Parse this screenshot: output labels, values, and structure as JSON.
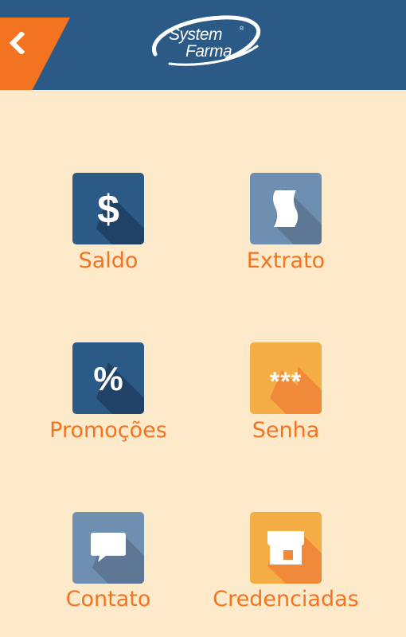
{
  "header": {
    "back_icon": "chevron-left-icon",
    "logo_line1": "System",
    "logo_line2": "Farma",
    "logo_reg": "®"
  },
  "menu": [
    {
      "label": "Saldo",
      "icon": "dollar-icon",
      "color": "#2c5a87",
      "glyph": "$"
    },
    {
      "label": "Extrato",
      "icon": "receipt-icon",
      "color": "#6f8fb0"
    },
    {
      "label": "Promoções",
      "icon": "percent-icon",
      "color": "#2c5a87",
      "glyph": "%"
    },
    {
      "label": "Senha",
      "icon": "password-icon",
      "color": "#f5ad45",
      "glyph": "***"
    },
    {
      "label": "Contato",
      "icon": "chat-bubble-icon",
      "color": "#6f8fb0"
    },
    {
      "label": "Credenciadas",
      "icon": "store-icon",
      "color": "#f5ad45"
    }
  ],
  "colors": {
    "background": "#fdeacb",
    "header": "#2c5a87",
    "accent": "#f37321"
  }
}
